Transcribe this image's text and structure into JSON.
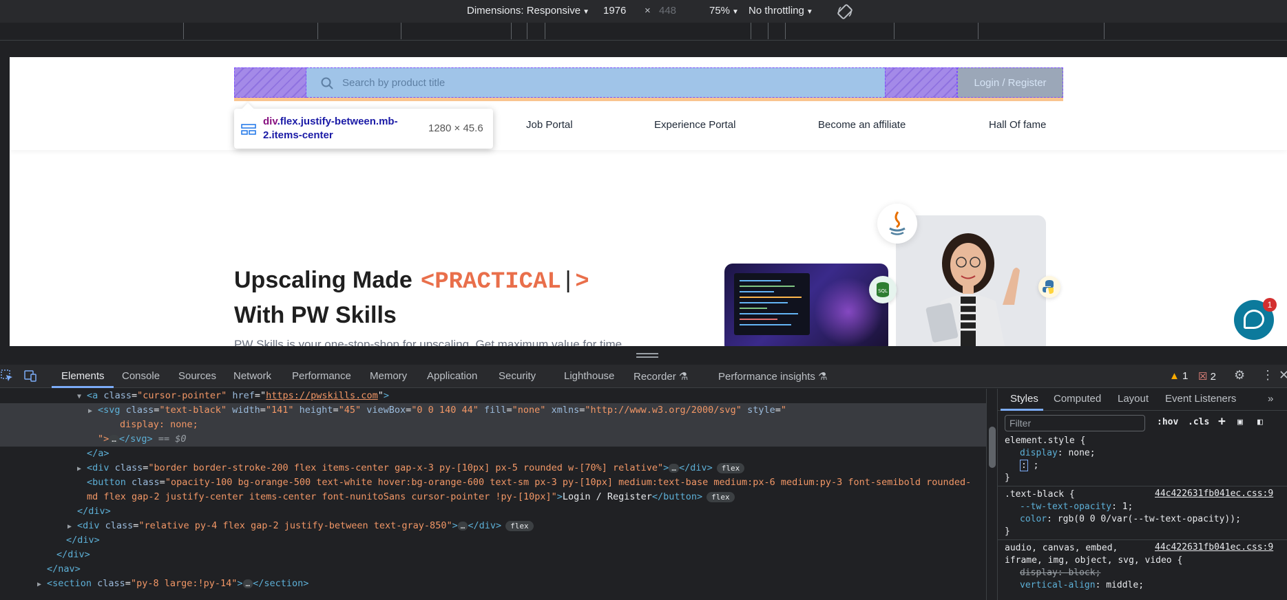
{
  "device_toolbar": {
    "dimensions_label": "Dimensions: Responsive",
    "width": "1976",
    "times": "×",
    "height_placeholder": "448",
    "zoom": "75%",
    "throttling": "No throttling"
  },
  "site": {
    "search_placeholder": "Search by product title",
    "login_button": "Login / Register",
    "nav_links": [
      "Job Portal",
      "Experience Portal",
      "Become an affiliate",
      "Hall Of fame"
    ],
    "tooltip": {
      "tag": "div",
      "selector": ".flex.justify-between.mb-2.items-center",
      "size": "1280 × 45.6"
    },
    "hero": {
      "line1": "Upscaling Made",
      "accent": "<PRACTICAL",
      "cursor": "|",
      "accent_end": ">",
      "line2": "With PW Skills",
      "subtitle": "PW Skills is your one-stop-shop for upscaling. Get maximum value for time"
    },
    "chat_badge": "1"
  },
  "devtools": {
    "tabs": [
      "Elements",
      "Console",
      "Sources",
      "Network",
      "Performance",
      "Memory",
      "Application",
      "Security",
      "Lighthouse",
      "Recorder",
      "Performance insights"
    ],
    "warnings": "1",
    "errors": "2",
    "code_lines": [
      {
        "a_tag": "<a ",
        "attr1": "class",
        "val1": "\"cursor-pointer\"",
        "attr2": "href",
        "val2": "https://pwskills.com",
        "close": ">"
      },
      {
        "svg_open": "<svg ",
        "attr1": "class",
        "val1": "\"text-black\"",
        "attr2": "width",
        "val2": "\"141\"",
        "attr3": "height",
        "val3": "\"45\"",
        "attr4": "viewBox",
        "val4": "\"0 0 140 44\"",
        "attr5": "fill",
        "val5": "\"none\"",
        "attr6": "xmlns",
        "val6": "\"http://www.w3.org/2000/svg\"",
        "attr7": "style",
        "val7": "\""
      },
      {
        "text": "display: none;"
      },
      {
        "close_quote": "\">",
        "ellipsis": "…",
        "svg_close": "</svg>",
        "eq": "== $0"
      },
      {
        "text": "</a>"
      },
      {
        "tag": "<div ",
        "attr": "class",
        "val": "\"border border-stroke-200 flex items-center gap-x-3 py-[10px] px-5 rounded w-[70%] relative\"",
        "after": ">",
        "ellipsis": "…",
        "close": "</div>",
        "badge": "flex"
      },
      {
        "tag": "<button ",
        "attr": "class",
        "val": "\"opacity-100 bg-orange-500 text-white hover:bg-orange-600 text-sm px-3 py-[10px] medium:text-base medium:px-6 medium:py-3 font-semibold rounded-"
      },
      {
        "val": "md flex gap-2 justify-center items-center font-nunitoSans cursor-pointer !py-[10px]\"",
        "after": ">",
        "text": "Login / Register",
        "close": "</button>",
        "badge": "flex"
      },
      {
        "text": "</div>"
      },
      {
        "tag": "<div ",
        "attr": "class",
        "val": "\"relative py-4 flex gap-2 justify-between text-gray-850\"",
        "after": ">",
        "ellipsis": "…",
        "close": "</div>",
        "badge": "flex"
      },
      {
        "text": "</div>"
      },
      {
        "text": "</div>"
      },
      {
        "text": "</nav>"
      },
      {
        "tag": "<section ",
        "attr": "class",
        "val": "\"py-8 large:!py-14\"",
        "after": ">",
        "ellipsis": "…",
        "close": "</section>"
      }
    ],
    "styles": {
      "tabs": [
        "Styles",
        "Computed",
        "Layout",
        "Event Listeners"
      ],
      "filter_placeholder": "Filter",
      "hov": ":hov",
      "cls": ".cls",
      "rules": [
        {
          "selector": "element.style {",
          "props": [
            {
              "p": "display",
              "v": "none;"
            },
            {
              "p": ":",
              "v": ";"
            }
          ],
          "close": "}"
        },
        {
          "selector": ".text-black {",
          "source": "44c422631fb041ec.css:9",
          "props": [
            {
              "p": "--tw-text-opacity",
              "v": "1;"
            },
            {
              "p": "color",
              "v": "rgb(0 0 0/var(--tw-text-opacity));"
            }
          ],
          "close": "}"
        },
        {
          "selector": "audio, canvas, embed,",
          "selector2": "iframe, img, object, svg, video {",
          "source": "44c422631fb041ec.css:9",
          "props": [
            {
              "p": "display",
              "v": "block;"
            },
            {
              "p": "vertical-align",
              "v": "middle;"
            }
          ]
        }
      ]
    }
  }
}
